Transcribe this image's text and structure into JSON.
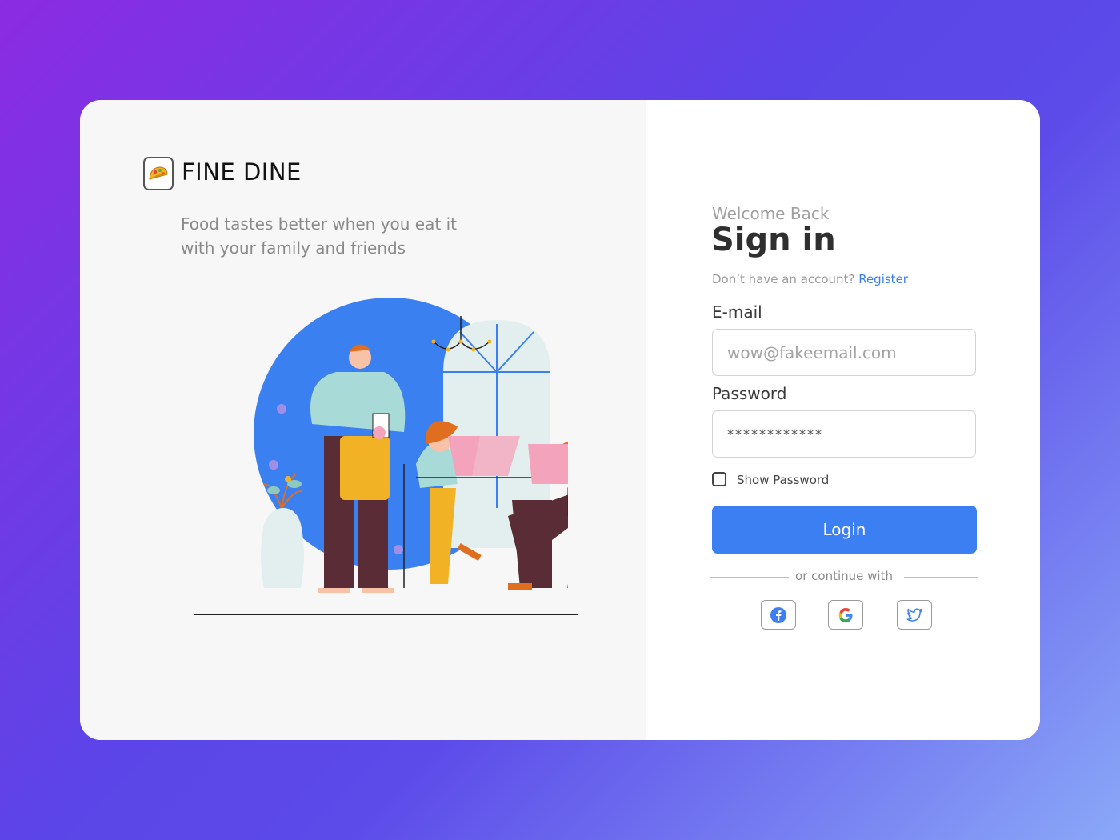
{
  "brand": {
    "name": "FINE DINE",
    "icon": "taco-icon",
    "tagline": "Food tastes better when you eat it with your family and friends"
  },
  "illustration": {
    "description_icon": "restaurant-illustration"
  },
  "signin": {
    "welcome": "Welcome Back",
    "title": "Sign in",
    "no_account_text": "Don’t have an account?",
    "register_link": "Register",
    "email_label": "E-mail",
    "email_placeholder": "wow@fakeemail.com",
    "password_label": "Password",
    "password_value": "************",
    "show_password_label": "Show Password",
    "show_password_checked": false,
    "login_button": "Login",
    "continue_with": "or continue with",
    "social": [
      "facebook-icon",
      "google-icon",
      "twitter-icon"
    ]
  },
  "colors": {
    "accent": "#3b7ff3",
    "link": "#3b7ff0",
    "background_gradient_start": "#8b2be2",
    "background_gradient_end": "#8aa8f8"
  }
}
